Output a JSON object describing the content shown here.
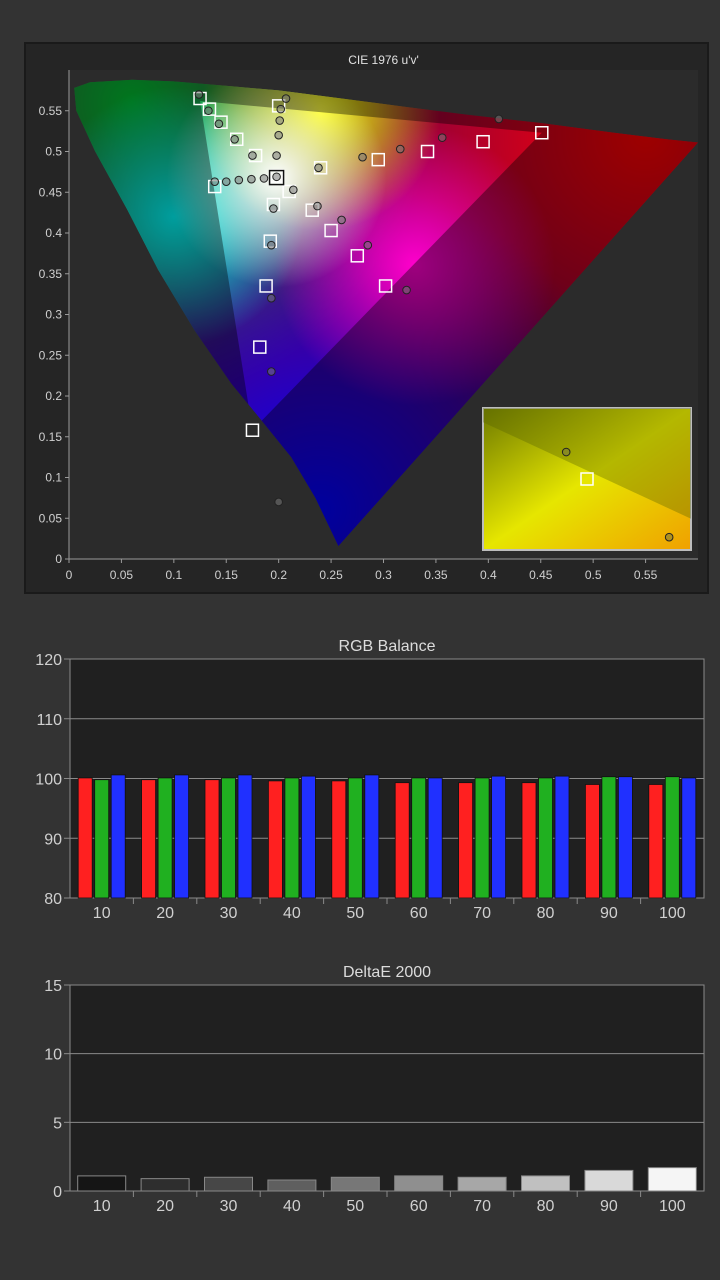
{
  "chart_data": [
    {
      "type": "scatter",
      "title": "CIE 1976 u'v'",
      "xlabel": "",
      "ylabel": "",
      "xlim": [
        0,
        0.6
      ],
      "ylim": [
        0,
        0.6
      ],
      "x_ticks": [
        "0",
        "0.05",
        "0.1",
        "0.15",
        "0.2",
        "0.25",
        "0.3",
        "0.35",
        "0.4",
        "0.45",
        "0.5",
        "0.55"
      ],
      "y_ticks": [
        "0",
        "0.05",
        "0.1",
        "0.15",
        "0.2",
        "0.25",
        "0.3",
        "0.35",
        "0.4",
        "0.45",
        "0.5",
        "0.55"
      ],
      "spectral_locus": [
        [
          0.257,
          0.016
        ],
        [
          0.235,
          0.075
        ],
        [
          0.212,
          0.125
        ],
        [
          0.185,
          0.168
        ],
        [
          0.155,
          0.215
        ],
        [
          0.12,
          0.28
        ],
        [
          0.085,
          0.355
        ],
        [
          0.055,
          0.43
        ],
        [
          0.025,
          0.5
        ],
        [
          0.007,
          0.55
        ],
        [
          0.005,
          0.578
        ],
        [
          0.02,
          0.585
        ],
        [
          0.06,
          0.588
        ],
        [
          0.1,
          0.586
        ],
        [
          0.155,
          0.58
        ],
        [
          0.2,
          0.575
        ],
        [
          0.26,
          0.565
        ],
        [
          0.32,
          0.555
        ],
        [
          0.38,
          0.545
        ],
        [
          0.45,
          0.535
        ],
        [
          0.52,
          0.523
        ],
        [
          0.57,
          0.515
        ],
        [
          0.6,
          0.511
        ]
      ],
      "gamut_triangle": {
        "red": [
          0.451,
          0.523
        ],
        "green": [
          0.125,
          0.562
        ],
        "blue": [
          0.175,
          0.158
        ]
      },
      "white_point": [
        0.198,
        0.468
      ],
      "target_squares": [
        [
          0.125,
          0.565
        ],
        [
          0.134,
          0.552
        ],
        [
          0.145,
          0.536
        ],
        [
          0.16,
          0.515
        ],
        [
          0.178,
          0.495
        ],
        [
          0.139,
          0.457
        ],
        [
          0.198,
          0.47
        ],
        [
          0.195,
          0.435
        ],
        [
          0.192,
          0.39
        ],
        [
          0.188,
          0.335
        ],
        [
          0.182,
          0.26
        ],
        [
          0.175,
          0.158
        ],
        [
          0.2,
          0.556
        ],
        [
          0.21,
          0.451
        ],
        [
          0.232,
          0.428
        ],
        [
          0.25,
          0.403
        ],
        [
          0.275,
          0.372
        ],
        [
          0.302,
          0.335
        ],
        [
          0.24,
          0.48
        ],
        [
          0.295,
          0.49
        ],
        [
          0.342,
          0.5
        ],
        [
          0.395,
          0.512
        ],
        [
          0.451,
          0.523
        ]
      ],
      "measured_points": [
        [
          0.124,
          0.57
        ],
        [
          0.133,
          0.55
        ],
        [
          0.143,
          0.534
        ],
        [
          0.158,
          0.515
        ],
        [
          0.175,
          0.495
        ],
        [
          0.139,
          0.463
        ],
        [
          0.15,
          0.463
        ],
        [
          0.162,
          0.465
        ],
        [
          0.174,
          0.466
        ],
        [
          0.186,
          0.467
        ],
        [
          0.198,
          0.469
        ],
        [
          0.195,
          0.43
        ],
        [
          0.193,
          0.385
        ],
        [
          0.193,
          0.32
        ],
        [
          0.193,
          0.23
        ],
        [
          0.2,
          0.07
        ],
        [
          0.198,
          0.495
        ],
        [
          0.2,
          0.52
        ],
        [
          0.201,
          0.538
        ],
        [
          0.202,
          0.552
        ],
        [
          0.207,
          0.565
        ],
        [
          0.214,
          0.453
        ],
        [
          0.237,
          0.433
        ],
        [
          0.26,
          0.416
        ],
        [
          0.285,
          0.385
        ],
        [
          0.322,
          0.33
        ],
        [
          0.238,
          0.48
        ],
        [
          0.28,
          0.493
        ],
        [
          0.316,
          0.503
        ],
        [
          0.356,
          0.517
        ],
        [
          0.41,
          0.54
        ]
      ],
      "inset": {
        "description_colors": [
          "#6e7a00",
          "#e6e600",
          "#f0a000"
        ],
        "target_square": [
          0.5,
          0.5
        ],
        "measured_points": [
          [
            0.895,
            0.91
          ],
          [
            0.4,
            0.31
          ]
        ]
      }
    },
    {
      "type": "bar",
      "title": "RGB Balance",
      "xlabel": "",
      "ylabel": "",
      "ylim": [
        80,
        120
      ],
      "y_ticks": [
        "80",
        "90",
        "100",
        "110",
        "120"
      ],
      "categories": [
        "10",
        "20",
        "30",
        "40",
        "50",
        "60",
        "70",
        "80",
        "90",
        "100"
      ],
      "series": [
        {
          "name": "",
          "color": "#ff2020",
          "values": [
            100.1,
            99.8,
            99.8,
            99.6,
            99.6,
            99.3,
            99.3,
            99.3,
            99.0,
            99.0
          ]
        },
        {
          "name": "",
          "color": "#20b020",
          "values": [
            99.8,
            100.1,
            100.1,
            100.1,
            100.1,
            100.1,
            100.1,
            100.1,
            100.3,
            100.3
          ]
        },
        {
          "name": "",
          "color": "#2030ff",
          "values": [
            100.6,
            100.6,
            100.6,
            100.4,
            100.6,
            100.1,
            100.4,
            100.4,
            100.3,
            100.1
          ]
        }
      ]
    },
    {
      "type": "bar",
      "title": "DeltaE 2000",
      "xlabel": "",
      "ylabel": "",
      "ylim": [
        0,
        15
      ],
      "y_ticks": [
        "0",
        "5",
        "10",
        "15"
      ],
      "categories": [
        "10",
        "20",
        "30",
        "40",
        "50",
        "60",
        "70",
        "80",
        "90",
        "100"
      ],
      "values": [
        1.1,
        0.9,
        1.0,
        0.8,
        1.0,
        1.1,
        1.0,
        1.1,
        1.5,
        1.7
      ],
      "bar_colors": [
        "#151515",
        "#2e2e2e",
        "#474747",
        "#5f5f5f",
        "#777777",
        "#8f8f8f",
        "#a7a7a7",
        "#c0c0c0",
        "#d9d9d9",
        "#f5f5f5"
      ]
    }
  ]
}
